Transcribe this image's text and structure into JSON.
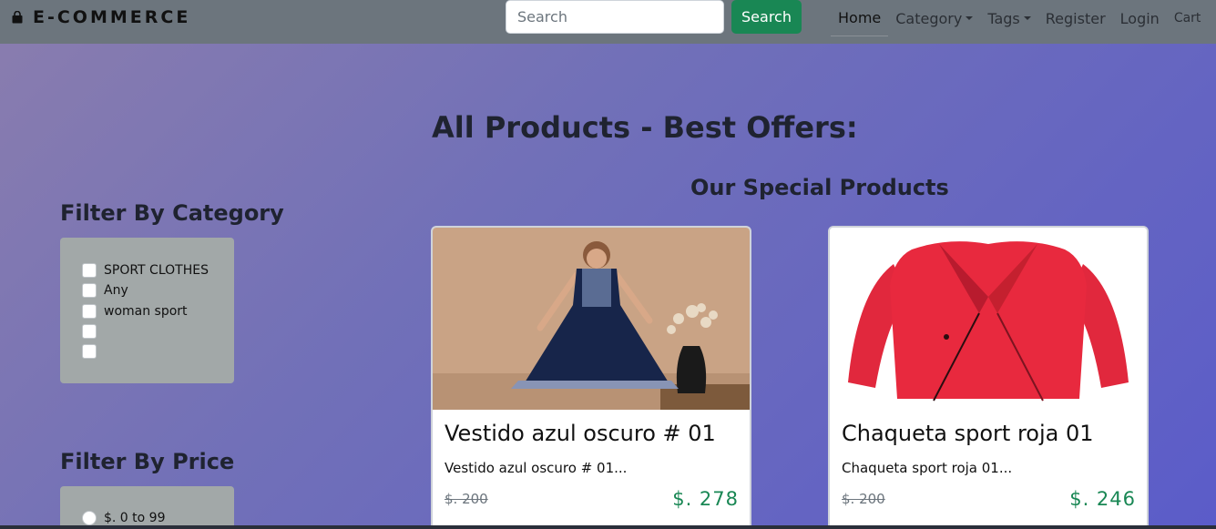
{
  "navbar": {
    "brand": "E-COMMERCE",
    "search_placeholder": "Search",
    "search_button": "Search",
    "links": {
      "home": "Home",
      "category": "Category",
      "tags": "Tags",
      "register": "Register",
      "login": "Login",
      "cart": "Cart"
    }
  },
  "main": {
    "title": "All Products - Best Offers:",
    "special_title": "Our Special Products"
  },
  "filters": {
    "category_title": "Filter By Category",
    "categories": [
      "SPORT CLOTHES",
      "Any",
      "woman sport",
      "",
      ""
    ],
    "price_title": "Filter By Price",
    "prices": [
      "$. 0 to 99"
    ]
  },
  "products": [
    {
      "name": "Vestido azul oscuro # 01",
      "description": "Vestido azul oscuro # 01...",
      "old_price": "$. 200",
      "price": "$. 278"
    },
    {
      "name": "Chaqueta sport roja 01",
      "description": "Chaqueta sport roja 01...",
      "old_price": "$. 200",
      "price": "$. 246"
    }
  ],
  "colors": {
    "navbar": "#6c757d",
    "search_button": "#198754",
    "price": "#198754",
    "filter_box": "#a2a8a8"
  }
}
